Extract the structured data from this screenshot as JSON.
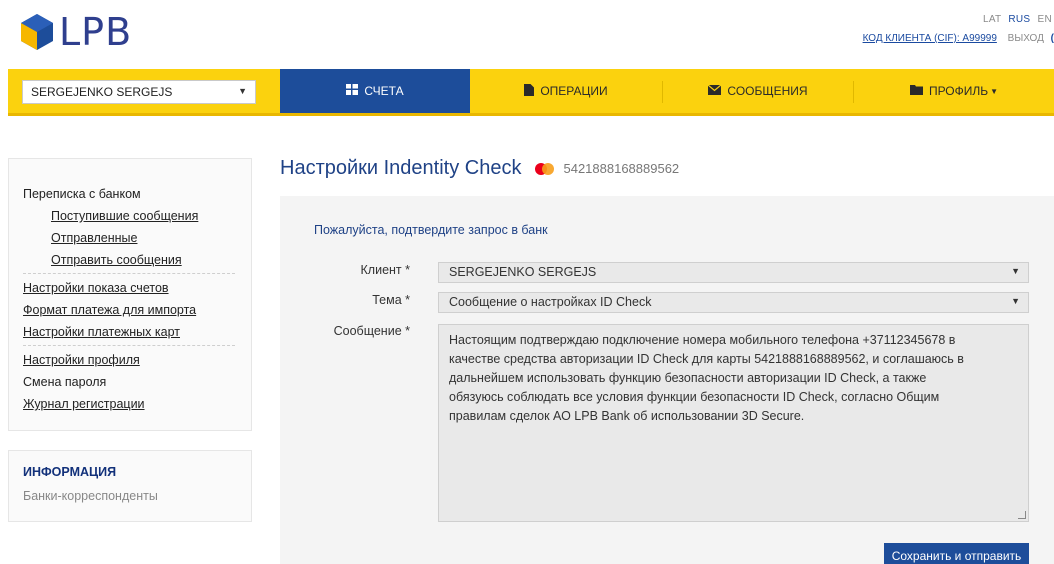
{
  "logo": {
    "text": "LPB"
  },
  "header": {
    "languages": [
      {
        "code": "LAT",
        "active": false
      },
      {
        "code": "RUS",
        "active": true
      },
      {
        "code": "EN",
        "active": false
      }
    ],
    "client_code": "КОД КЛИЕНТА (CIF): A99999",
    "logout": "ВЫХОД",
    "logout_tail": "("
  },
  "nav": {
    "account_select": "SERGEJENKO SERGEJS",
    "items": [
      {
        "label": "СЧЕТА",
        "icon": "grid-icon",
        "active": true
      },
      {
        "label": "ОПЕРАЦИИ",
        "icon": "document-icon",
        "active": false
      },
      {
        "label": "СООБЩЕНИЯ",
        "icon": "envelope-icon",
        "active": false
      },
      {
        "label": "ПРОФИЛЬ",
        "icon": "folder-icon",
        "active": false,
        "dropdown": true
      }
    ]
  },
  "sidebar": {
    "group1_title": "Переписка с банком",
    "inbox": "Поступившие сообщения",
    "sent": "Отправленные",
    "send": "Отправить сообщения",
    "account_display": "Настройки показа счетов",
    "payment_format": "Формат платежа для импорта",
    "card_settings": "Настройки платежных карт",
    "profile_settings": "Настройки профиля",
    "change_password": "Смена пароля",
    "log": "Журнал регистрации",
    "info_header": "ИНФОРМАЦИЯ",
    "correspondent_banks": "Банки-корреспонденты"
  },
  "main": {
    "title": "Настройки Indentity Check",
    "card_number": "5421888168889562",
    "prompt": "Пожалуйста, подтвердите запрос в банк",
    "client_label": "Клиент *",
    "client_value": "SERGEJENKO SERGEJS",
    "topic_label": "Тема *",
    "topic_value": "Сообщение о настройках ID Check",
    "message_label": "Сообщение *",
    "message_lines": [
      "Настоящим подтверждаю подключение номера мобильного телефона +37112345678 в",
      "качестве средства авторизации ID Check для карты 5421888168889562, и соглашаюсь в",
      "дальнейшем использовать функцию безопасности авторизации ID Check, а также",
      "обязуюсь соблюдать все условия функции безопасности ID Check, согласно Общим",
      "правилам сделок АО LPB Bank об использовании 3D Secure."
    ],
    "submit": "Сохранить и отправить"
  },
  "colors": {
    "nav_yellow": "#fbd20e",
    "brand_blue": "#1d4d9a",
    "title_blue": "#1f4286",
    "logo_yellow": "#f6b700"
  }
}
